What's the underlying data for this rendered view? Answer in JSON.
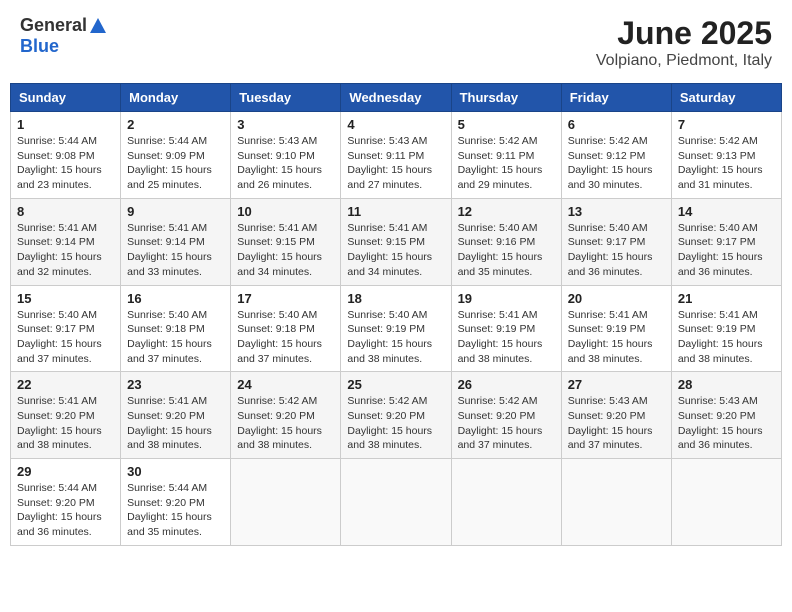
{
  "header": {
    "logo_general": "General",
    "logo_blue": "Blue",
    "month": "June 2025",
    "location": "Volpiano, Piedmont, Italy"
  },
  "days_of_week": [
    "Sunday",
    "Monday",
    "Tuesday",
    "Wednesday",
    "Thursday",
    "Friday",
    "Saturday"
  ],
  "weeks": [
    [
      {
        "day": "1",
        "sunrise": "Sunrise: 5:44 AM",
        "sunset": "Sunset: 9:08 PM",
        "daylight": "Daylight: 15 hours and 23 minutes."
      },
      {
        "day": "2",
        "sunrise": "Sunrise: 5:44 AM",
        "sunset": "Sunset: 9:09 PM",
        "daylight": "Daylight: 15 hours and 25 minutes."
      },
      {
        "day": "3",
        "sunrise": "Sunrise: 5:43 AM",
        "sunset": "Sunset: 9:10 PM",
        "daylight": "Daylight: 15 hours and 26 minutes."
      },
      {
        "day": "4",
        "sunrise": "Sunrise: 5:43 AM",
        "sunset": "Sunset: 9:11 PM",
        "daylight": "Daylight: 15 hours and 27 minutes."
      },
      {
        "day": "5",
        "sunrise": "Sunrise: 5:42 AM",
        "sunset": "Sunset: 9:11 PM",
        "daylight": "Daylight: 15 hours and 29 minutes."
      },
      {
        "day": "6",
        "sunrise": "Sunrise: 5:42 AM",
        "sunset": "Sunset: 9:12 PM",
        "daylight": "Daylight: 15 hours and 30 minutes."
      },
      {
        "day": "7",
        "sunrise": "Sunrise: 5:42 AM",
        "sunset": "Sunset: 9:13 PM",
        "daylight": "Daylight: 15 hours and 31 minutes."
      }
    ],
    [
      {
        "day": "8",
        "sunrise": "Sunrise: 5:41 AM",
        "sunset": "Sunset: 9:14 PM",
        "daylight": "Daylight: 15 hours and 32 minutes."
      },
      {
        "day": "9",
        "sunrise": "Sunrise: 5:41 AM",
        "sunset": "Sunset: 9:14 PM",
        "daylight": "Daylight: 15 hours and 33 minutes."
      },
      {
        "day": "10",
        "sunrise": "Sunrise: 5:41 AM",
        "sunset": "Sunset: 9:15 PM",
        "daylight": "Daylight: 15 hours and 34 minutes."
      },
      {
        "day": "11",
        "sunrise": "Sunrise: 5:41 AM",
        "sunset": "Sunset: 9:15 PM",
        "daylight": "Daylight: 15 hours and 34 minutes."
      },
      {
        "day": "12",
        "sunrise": "Sunrise: 5:40 AM",
        "sunset": "Sunset: 9:16 PM",
        "daylight": "Daylight: 15 hours and 35 minutes."
      },
      {
        "day": "13",
        "sunrise": "Sunrise: 5:40 AM",
        "sunset": "Sunset: 9:17 PM",
        "daylight": "Daylight: 15 hours and 36 minutes."
      },
      {
        "day": "14",
        "sunrise": "Sunrise: 5:40 AM",
        "sunset": "Sunset: 9:17 PM",
        "daylight": "Daylight: 15 hours and 36 minutes."
      }
    ],
    [
      {
        "day": "15",
        "sunrise": "Sunrise: 5:40 AM",
        "sunset": "Sunset: 9:17 PM",
        "daylight": "Daylight: 15 hours and 37 minutes."
      },
      {
        "day": "16",
        "sunrise": "Sunrise: 5:40 AM",
        "sunset": "Sunset: 9:18 PM",
        "daylight": "Daylight: 15 hours and 37 minutes."
      },
      {
        "day": "17",
        "sunrise": "Sunrise: 5:40 AM",
        "sunset": "Sunset: 9:18 PM",
        "daylight": "Daylight: 15 hours and 37 minutes."
      },
      {
        "day": "18",
        "sunrise": "Sunrise: 5:40 AM",
        "sunset": "Sunset: 9:19 PM",
        "daylight": "Daylight: 15 hours and 38 minutes."
      },
      {
        "day": "19",
        "sunrise": "Sunrise: 5:41 AM",
        "sunset": "Sunset: 9:19 PM",
        "daylight": "Daylight: 15 hours and 38 minutes."
      },
      {
        "day": "20",
        "sunrise": "Sunrise: 5:41 AM",
        "sunset": "Sunset: 9:19 PM",
        "daylight": "Daylight: 15 hours and 38 minutes."
      },
      {
        "day": "21",
        "sunrise": "Sunrise: 5:41 AM",
        "sunset": "Sunset: 9:19 PM",
        "daylight": "Daylight: 15 hours and 38 minutes."
      }
    ],
    [
      {
        "day": "22",
        "sunrise": "Sunrise: 5:41 AM",
        "sunset": "Sunset: 9:20 PM",
        "daylight": "Daylight: 15 hours and 38 minutes."
      },
      {
        "day": "23",
        "sunrise": "Sunrise: 5:41 AM",
        "sunset": "Sunset: 9:20 PM",
        "daylight": "Daylight: 15 hours and 38 minutes."
      },
      {
        "day": "24",
        "sunrise": "Sunrise: 5:42 AM",
        "sunset": "Sunset: 9:20 PM",
        "daylight": "Daylight: 15 hours and 38 minutes."
      },
      {
        "day": "25",
        "sunrise": "Sunrise: 5:42 AM",
        "sunset": "Sunset: 9:20 PM",
        "daylight": "Daylight: 15 hours and 38 minutes."
      },
      {
        "day": "26",
        "sunrise": "Sunrise: 5:42 AM",
        "sunset": "Sunset: 9:20 PM",
        "daylight": "Daylight: 15 hours and 37 minutes."
      },
      {
        "day": "27",
        "sunrise": "Sunrise: 5:43 AM",
        "sunset": "Sunset: 9:20 PM",
        "daylight": "Daylight: 15 hours and 37 minutes."
      },
      {
        "day": "28",
        "sunrise": "Sunrise: 5:43 AM",
        "sunset": "Sunset: 9:20 PM",
        "daylight": "Daylight: 15 hours and 36 minutes."
      }
    ],
    [
      {
        "day": "29",
        "sunrise": "Sunrise: 5:44 AM",
        "sunset": "Sunset: 9:20 PM",
        "daylight": "Daylight: 15 hours and 36 minutes."
      },
      {
        "day": "30",
        "sunrise": "Sunrise: 5:44 AM",
        "sunset": "Sunset: 9:20 PM",
        "daylight": "Daylight: 15 hours and 35 minutes."
      },
      null,
      null,
      null,
      null,
      null
    ]
  ]
}
